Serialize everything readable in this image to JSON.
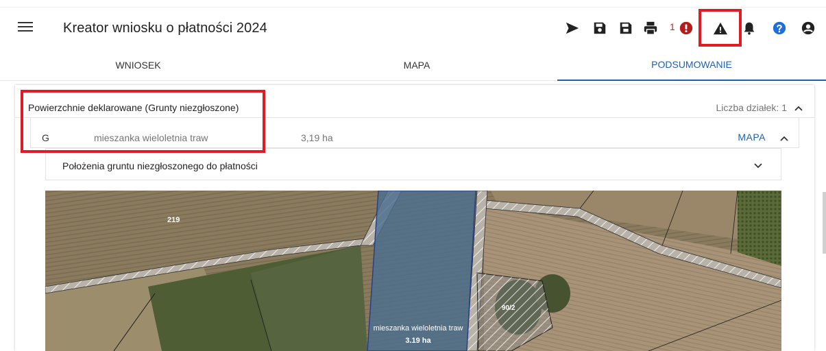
{
  "header": {
    "title": "Kreator wniosku o płatności 2024",
    "error_count": "1"
  },
  "toolbar": {
    "icons": [
      "send-icon",
      "save-icon",
      "save-as-icon",
      "print-icon",
      "error-icon",
      "warning-icon",
      "bell-icon",
      "help-icon",
      "account-icon"
    ]
  },
  "tabs": [
    {
      "label": "WNIOSEK"
    },
    {
      "label": "MAPA"
    },
    {
      "label": "PODSUMOWANIE",
      "active": true
    }
  ],
  "section": {
    "title": "Powierzchnie deklarowane (Grunty niezgłoszone)",
    "count_label": "Liczba działek: 1"
  },
  "parcel": {
    "code": "G",
    "crop": "mieszanka wieloletnia traw",
    "area": "3,19 ha",
    "map_link": "MAPA"
  },
  "location": {
    "label": "Położenia gruntu niezgłoszonego do płatności"
  },
  "map": {
    "labels": {
      "parcel_219": "219",
      "parcel_902": "90/2",
      "crop_name": "mieszanka wieloletnia traw",
      "crop_area": "3.19 ha"
    }
  },
  "colors": {
    "accent": "#1f5fb4",
    "highlight": "#e01b24",
    "error": "#c62828",
    "help": "#1e6fd9"
  }
}
